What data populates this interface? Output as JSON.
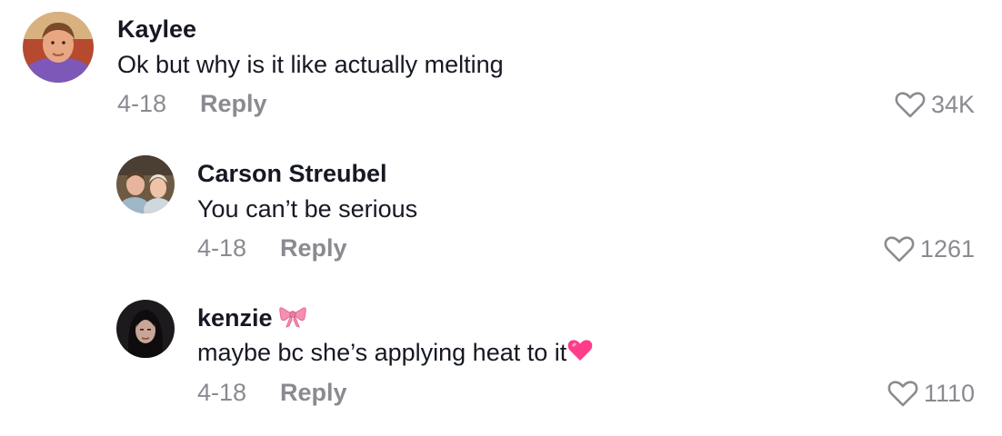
{
  "comments": [
    {
      "username": "Kaylee",
      "text": "Ok but why is it like actually melting",
      "date": "4-18",
      "reply_label": "Reply",
      "likes": "34K"
    },
    {
      "username": "Carson Streubel",
      "text": "You can’t be serious",
      "date": "4-18",
      "reply_label": "Reply",
      "likes": "1261"
    },
    {
      "username": "kenzie",
      "username_emoji": "bow-emoji",
      "text": "maybe bc she’s applying heat to it",
      "text_emoji": "pink-heart-emoji",
      "date": "4-18",
      "reply_label": "Reply",
      "likes": "1110"
    }
  ],
  "colors": {
    "primary_text": "#161823",
    "secondary_text": "#8a8b91",
    "heart_emoji": "#ff3d8b",
    "bow_emoji": "#f48fb1"
  }
}
